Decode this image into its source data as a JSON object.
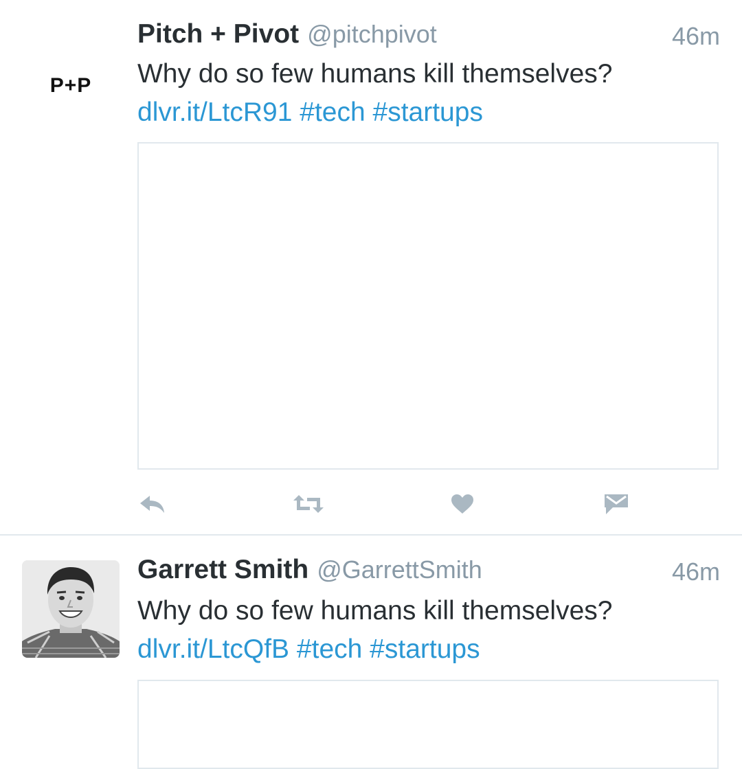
{
  "theme": {
    "link_color": "#2b97d4",
    "muted_color": "#8899a6",
    "text_color": "#292f33",
    "action_icon_color": "#aab8c2"
  },
  "tweets": [
    {
      "name": "Pitch + Pivot",
      "handle": "@pitchpivot",
      "time": "46m",
      "avatar_text": "P+P",
      "text": "Why do so few humans kill themselves?",
      "link": "dlvr.it/LtcR91",
      "hashtags": "#tech #startups",
      "actions": {
        "reply_icon": "reply-icon",
        "retweet_icon": "retweet-icon",
        "like_icon": "heart-icon",
        "dm_icon": "direct-message-icon"
      }
    },
    {
      "name": "Garrett Smith",
      "handle": "@GarrettSmith",
      "time": "46m",
      "avatar_icon": "profile-photo",
      "text": "Why do so few humans kill themselves?",
      "link": "dlvr.it/LtcQfB",
      "hashtags": "#tech #startups"
    }
  ]
}
